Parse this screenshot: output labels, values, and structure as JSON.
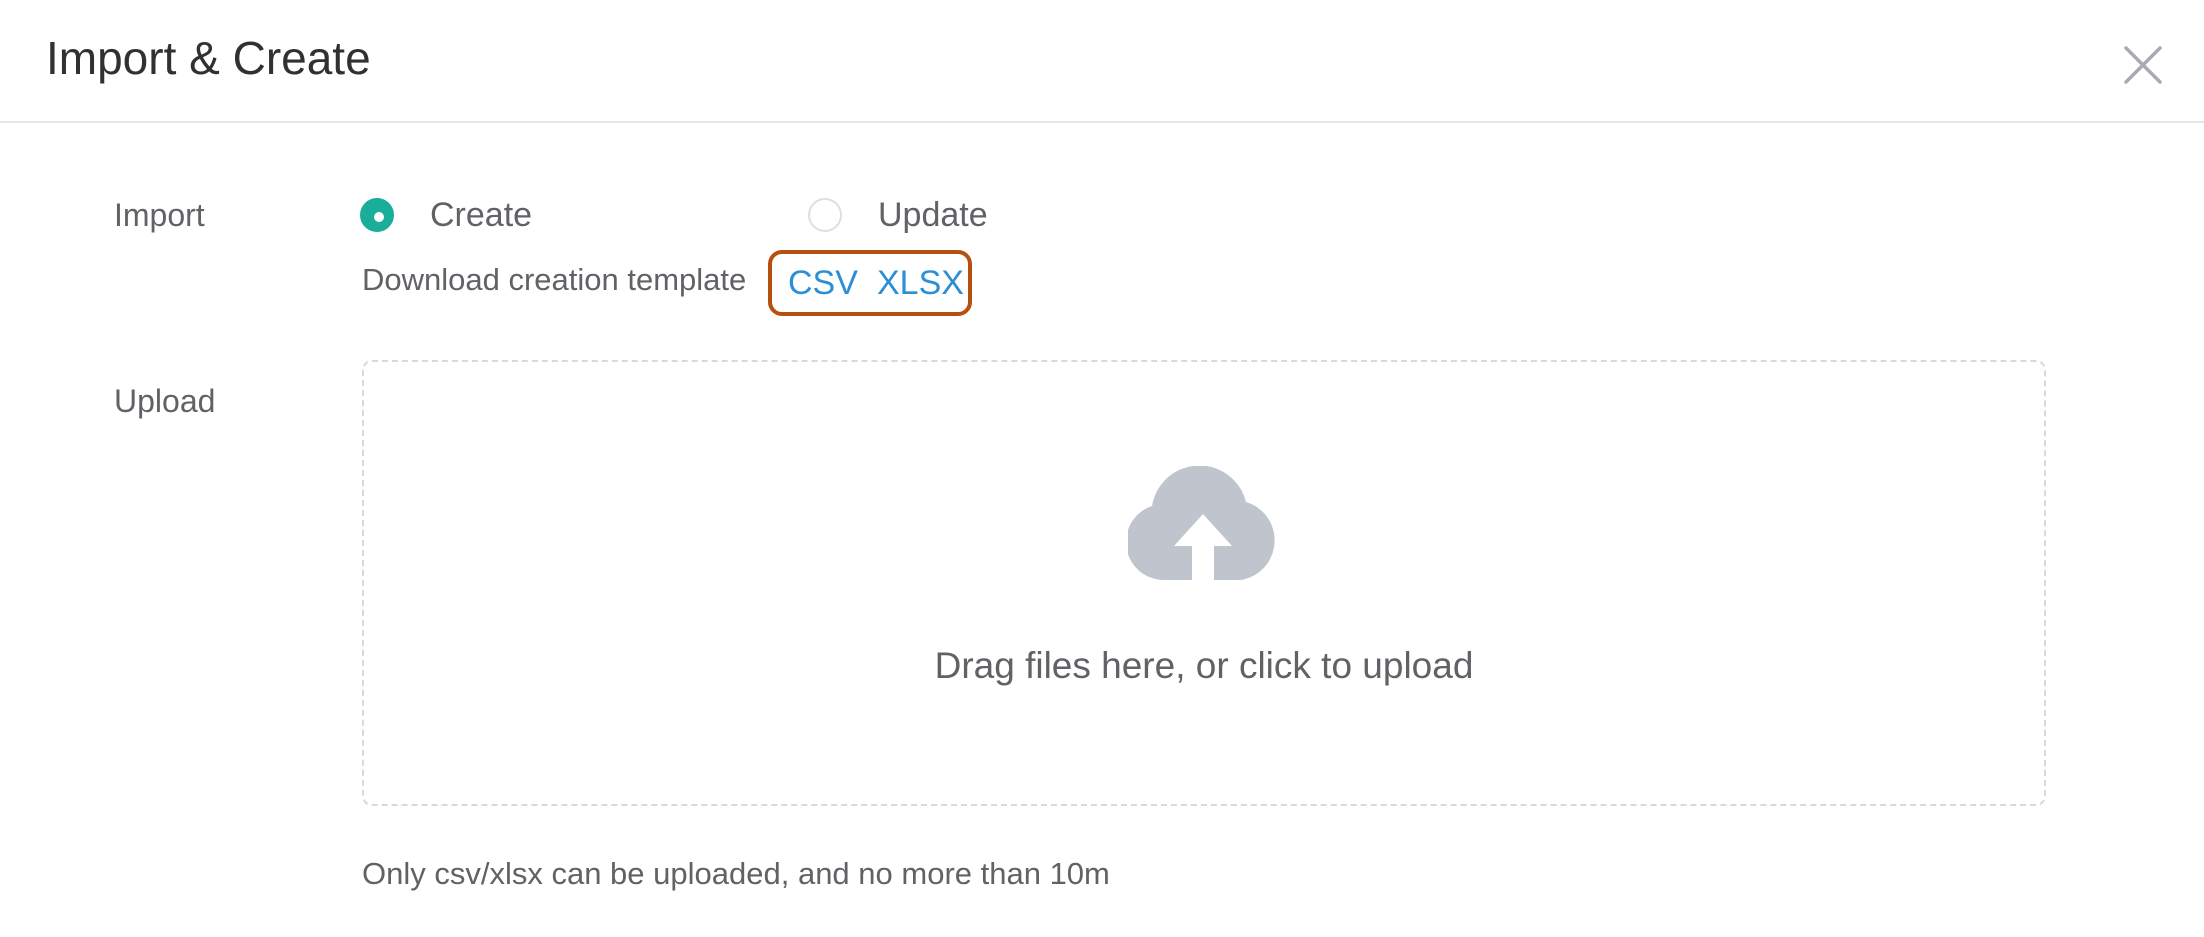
{
  "dialog": {
    "title": "Import & Create",
    "close_icon": "close-icon"
  },
  "import": {
    "label": "Import",
    "options": [
      {
        "label": "Create",
        "selected": true
      },
      {
        "label": "Update",
        "selected": false
      }
    ],
    "template_text": "Download creation template",
    "links": {
      "csv": "CSV",
      "xlsx": "XLSX"
    }
  },
  "upload": {
    "label": "Upload",
    "icon": "cloud-upload-icon",
    "drop_text": "Drag files here, or click to upload",
    "tip": "Only csv/xlsx can be uploaded, and no more than 10m"
  },
  "colors": {
    "accent": "#1aad9a",
    "link": "#2b8fd6",
    "highlight_box": "#b5500f",
    "icon_gray": "#c0c4cc"
  }
}
